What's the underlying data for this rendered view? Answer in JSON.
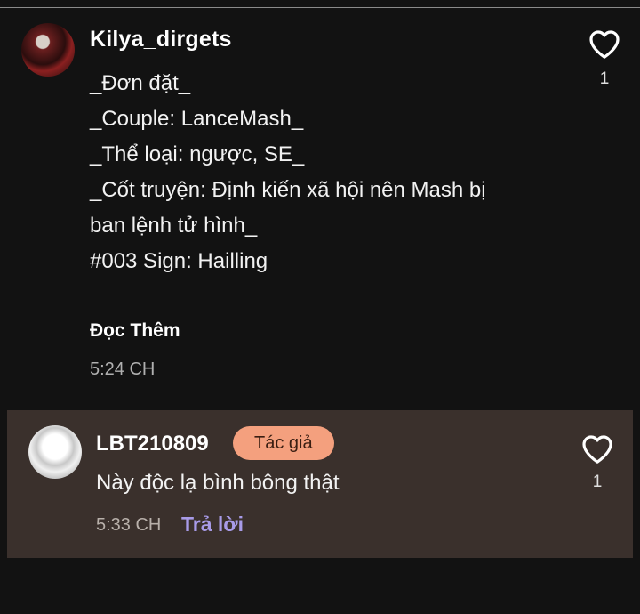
{
  "comment": {
    "username": "Kilya_dirgets",
    "lines": [
      "_Đơn đặt_",
      "_Couple: LanceMash_",
      "_Thể loại: ngược, SE_",
      "_Cốt truyện: Định kiến xã hội nên Mash bị",
      "ban lệnh tử hình_",
      "#003 Sign: Hailling"
    ],
    "read_more": "Đọc Thêm",
    "time": "5:24 CH",
    "like_count": "1",
    "like_icon": "heart-outline-icon"
  },
  "reply": {
    "username": "LBT210809",
    "badge": "Tác giả",
    "text": "Này độc lạ bình bông thật",
    "time": "5:33 CH",
    "reply_label": "Trả lời",
    "like_count": "1",
    "like_icon": "heart-outline-icon"
  },
  "colors": {
    "background": "#121212",
    "reply_background": "#3a302c",
    "badge": "#f4a07e",
    "reply_link": "#a89be8"
  }
}
